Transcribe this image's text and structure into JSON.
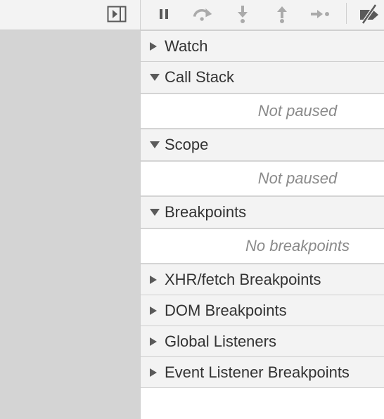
{
  "toolbar": {
    "left": {
      "show_navigator_icon": "sidebar-toggle-icon"
    },
    "right": {
      "buttons": [
        {
          "name": "pause",
          "icon": "pause-icon"
        },
        {
          "name": "step-over",
          "icon": "step-over-icon"
        },
        {
          "name": "step-into",
          "icon": "step-into-icon"
        },
        {
          "name": "step-out",
          "icon": "step-out-icon"
        },
        {
          "name": "step",
          "icon": "step-icon"
        },
        {
          "name": "deactivate-breakpoints",
          "icon": "breakpoints-toggle-icon"
        }
      ]
    }
  },
  "sections": {
    "watch": {
      "label": "Watch",
      "expanded": false
    },
    "call_stack": {
      "label": "Call Stack",
      "expanded": true,
      "message": "Not paused"
    },
    "scope": {
      "label": "Scope",
      "expanded": true,
      "message": "Not paused"
    },
    "breakpoints": {
      "label": "Breakpoints",
      "expanded": true,
      "message": "No breakpoints"
    },
    "xhr_breakpoints": {
      "label": "XHR/fetch Breakpoints",
      "expanded": false
    },
    "dom_breakpoints": {
      "label": "DOM Breakpoints",
      "expanded": false
    },
    "global_listeners": {
      "label": "Global Listeners",
      "expanded": false
    },
    "event_listener_breakpoints": {
      "label": "Event Listener Breakpoints",
      "expanded": false
    }
  },
  "colors": {
    "toolbar_bg": "#f3f3f3",
    "left_pane_bg": "#d4d4d4",
    "icon_active": "#5a5a5a",
    "icon_disabled": "#aaaaaa",
    "placeholder_text": "#8a8a8a"
  }
}
